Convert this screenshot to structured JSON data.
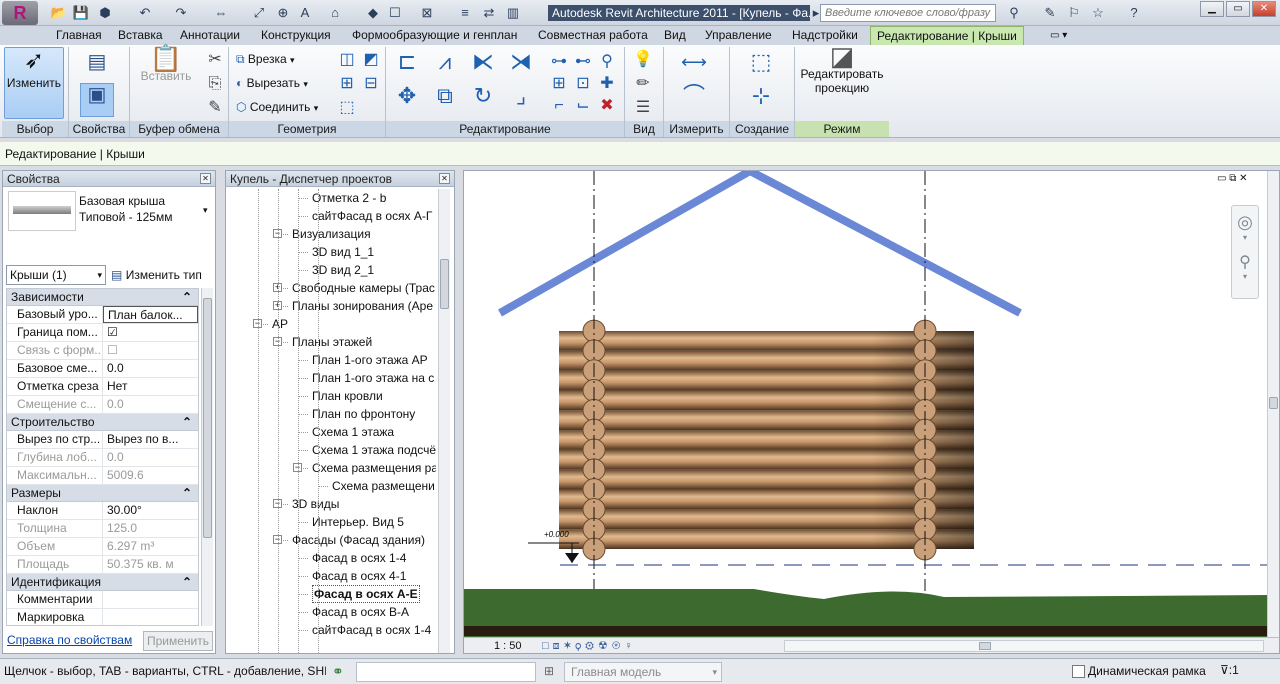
{
  "app": {
    "logo": "R",
    "title": "Autodesk Revit Architecture 2011 - [Купель - Фа...",
    "search_placeholder": "Введите ключевое слово/фразу"
  },
  "tabs": [
    {
      "label": "Главная"
    },
    {
      "label": "Вставка"
    },
    {
      "label": "Аннотации"
    },
    {
      "label": "Конструкция"
    },
    {
      "label": "Формообразующие и генплан"
    },
    {
      "label": "Совместная работа"
    },
    {
      "label": "Вид"
    },
    {
      "label": "Управление"
    },
    {
      "label": "Надстройки"
    },
    {
      "label": "Редактирование | Крыши",
      "active": true
    }
  ],
  "ribbon": {
    "modify_label": "Изменить",
    "paste_label": "Вставить",
    "cut_geom": "Врезка",
    "cut": "Вырезать",
    "join": "Соединить",
    "edit_footprint_line1": "Редактировать",
    "edit_footprint_line2": "проекцию",
    "panels": {
      "select": "Выбор",
      "properties": "Свойства",
      "clipboard": "Буфер обмена",
      "geometry": "Геометрия",
      "modify": "Редактирование",
      "view": "Вид",
      "measure": "Измерить",
      "create": "Создание",
      "mode": "Режим"
    }
  },
  "context_bar": "Редактирование | Крыши",
  "properties": {
    "title": "Свойства",
    "type_line1": "Базовая крыша",
    "type_line2": "Типовой - 125мм",
    "filter": "Крыши (1)",
    "edit_type": "Изменить тип",
    "groups": [
      {
        "name": "Зависимости",
        "rows": [
          {
            "k": "Базовый уро...",
            "v": "План балок...",
            "disabled": false
          },
          {
            "k": "Граница пом...",
            "v": "☑",
            "disabled": false
          },
          {
            "k": "Связь с форм...",
            "v": "☐",
            "disabled": true
          },
          {
            "k": "Базовое сме...",
            "v": "0.0",
            "disabled": false
          },
          {
            "k": "Отметка среза",
            "v": "Нет",
            "disabled": false
          },
          {
            "k": "Смещение с...",
            "v": "0.0",
            "disabled": true
          }
        ]
      },
      {
        "name": "Строительство",
        "rows": [
          {
            "k": "Вырез по стр...",
            "v": "Вырез по в...",
            "disabled": false
          },
          {
            "k": "Глубина лоб...",
            "v": "0.0",
            "disabled": true
          },
          {
            "k": "Максимальн...",
            "v": "5009.6",
            "disabled": true
          }
        ]
      },
      {
        "name": "Размеры",
        "rows": [
          {
            "k": "Наклон",
            "v": "30.00°",
            "disabled": false
          },
          {
            "k": "Толщина",
            "v": "125.0",
            "disabled": true
          },
          {
            "k": "Объем",
            "v": "6.297 m³",
            "disabled": true
          },
          {
            "k": "Площадь",
            "v": "50.375 кв. м",
            "disabled": true
          }
        ]
      },
      {
        "name": "Идентификация",
        "rows": [
          {
            "k": "Комментарии",
            "v": "",
            "disabled": false
          },
          {
            "k": "Маркировка",
            "v": "",
            "disabled": false
          }
        ]
      }
    ],
    "help_link": "Справка по свойствам",
    "apply": "Применить"
  },
  "browser": {
    "title": "Купель - Диспетчер проектов",
    "items": [
      {
        "label": "Отметка 2 - b",
        "level": 3,
        "toggle": ""
      },
      {
        "label": "сайтФасад в осях А-Г",
        "level": 3,
        "toggle": ""
      },
      {
        "label": "Визуализация",
        "level": 2,
        "toggle": "−"
      },
      {
        "label": "3D вид 1_1",
        "level": 3,
        "toggle": ""
      },
      {
        "label": "3D вид 2_1",
        "level": 3,
        "toggle": ""
      },
      {
        "label": "Свободные камеры (Трас",
        "level": 2,
        "toggle": "+"
      },
      {
        "label": "Планы зонирования (Аре",
        "level": 2,
        "toggle": "+"
      },
      {
        "label": "АР",
        "level": 1,
        "toggle": "−"
      },
      {
        "label": "Планы этажей",
        "level": 2,
        "toggle": "−"
      },
      {
        "label": "План 1-ого этажа АР",
        "level": 3,
        "toggle": ""
      },
      {
        "label": "План 1-ого этажа на с",
        "level": 3,
        "toggle": ""
      },
      {
        "label": "План кровли",
        "level": 3,
        "toggle": ""
      },
      {
        "label": "План по фронтону",
        "level": 3,
        "toggle": ""
      },
      {
        "label": "Схема 1 этажа",
        "level": 3,
        "toggle": ""
      },
      {
        "label": "Схема 1 этажа подсчё",
        "level": 3,
        "toggle": ""
      },
      {
        "label": "Схема размещения ра",
        "level": 3,
        "toggle": "−"
      },
      {
        "label": "Схема размещени",
        "level": 4,
        "toggle": ""
      },
      {
        "label": "3D виды",
        "level": 2,
        "toggle": "−"
      },
      {
        "label": "Интерьер. Вид 5",
        "level": 3,
        "toggle": ""
      },
      {
        "label": "Фасады (Фасад здания)",
        "level": 2,
        "toggle": "−"
      },
      {
        "label": "Фасад в осях 1-4",
        "level": 3,
        "toggle": ""
      },
      {
        "label": "Фасад в осях 4-1",
        "level": 3,
        "toggle": ""
      },
      {
        "label": "Фасад в осях А-Е",
        "level": 3,
        "toggle": "",
        "bold": true
      },
      {
        "label": "Фасад в осях В-А",
        "level": 3,
        "toggle": ""
      },
      {
        "label": "сайтФасад в осях 1-4",
        "level": 3,
        "toggle": ""
      }
    ]
  },
  "viewport": {
    "level_mark": "+0.000",
    "scale": "1 : 50"
  },
  "status": {
    "hint": "Щелчок - выбор, TAB - варианты, CTRL - добавление, SHIF",
    "model": "Главная модель",
    "dynamic": "Динамическая рамка",
    "filter_count": ":1"
  },
  "colors": {
    "roof": "#6b88d6",
    "active_tab": "#c8e8b0",
    "ground": "#3d6b2f"
  }
}
